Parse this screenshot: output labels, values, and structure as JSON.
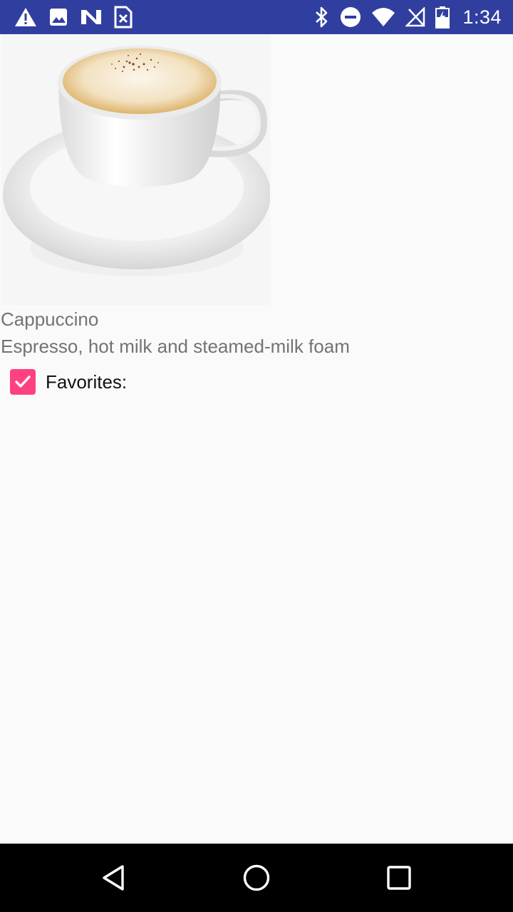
{
  "status_bar": {
    "time": "1:34",
    "background": "#303f9f",
    "left_icons": [
      "warning-icon",
      "image-icon",
      "n-logo-icon",
      "sim-error-icon"
    ],
    "right_icons": [
      "bluetooth-icon",
      "do-not-disturb-icon",
      "wifi-icon",
      "signal-off-icon",
      "battery-icon"
    ]
  },
  "coffee": {
    "name": "Cappuccino",
    "description": "Espresso, hot milk and steamed-milk foam",
    "image": "cappuccino-cup-image"
  },
  "favorites": {
    "label": "Favorites:",
    "checked": true,
    "accent": "#ff4081"
  },
  "nav_bar": {
    "buttons": [
      "back-icon",
      "home-icon",
      "recents-icon"
    ]
  }
}
